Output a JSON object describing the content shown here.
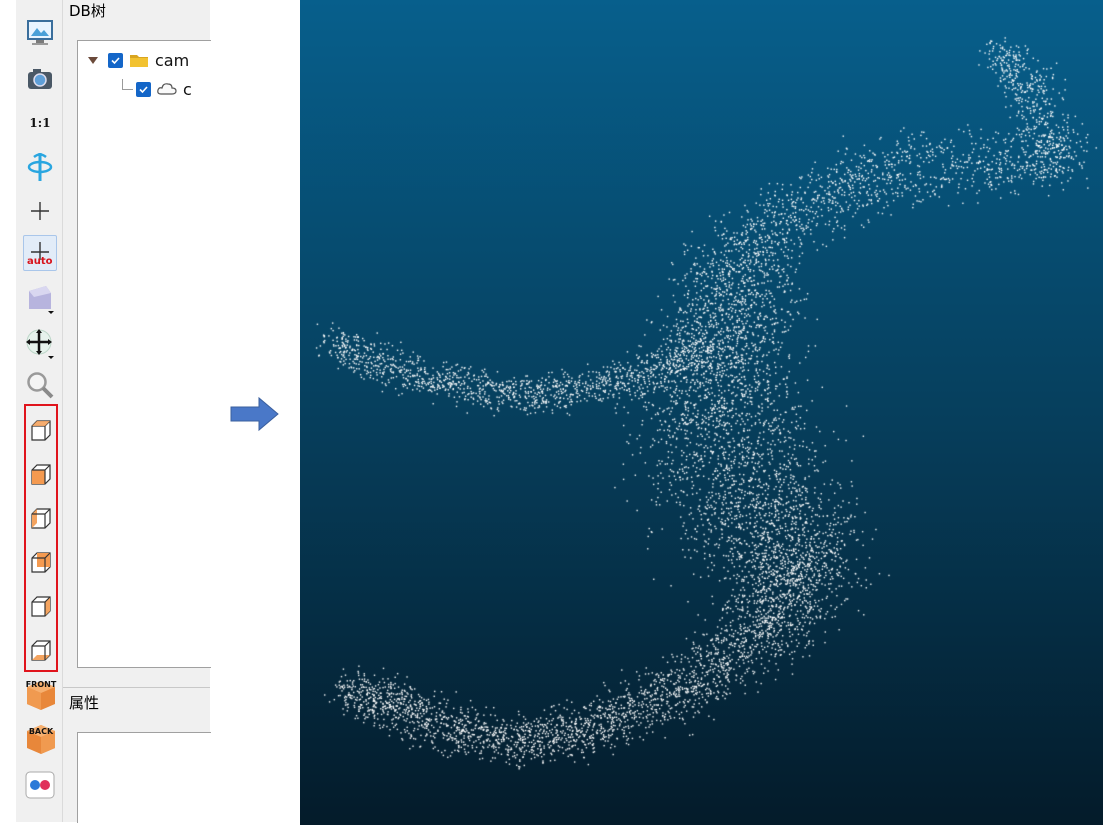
{
  "toolbar": {
    "zoom_label": "1:1",
    "front_label": "FRONT",
    "back_label": "BACK",
    "auto_label": "auto",
    "buttons": [
      "display-settings-icon",
      "camera-settings-icon",
      "zoom-1-1-icon",
      "rotation-icon",
      "pivot-icon",
      "pivot-auto-icon",
      "perspective-icon",
      "move-icon",
      "zoom-icon",
      "top-view-icon",
      "front-view-icon",
      "left-view-icon",
      "back-view-icon",
      "right-view-icon",
      "bottom-view-icon",
      "iso-front-icon",
      "iso-back-icon",
      "stereo-icon"
    ]
  },
  "db_tree": {
    "title": "DB树",
    "items": [
      {
        "label": "cam",
        "checked": true,
        "expanded": true,
        "icon": "folder-icon"
      },
      {
        "label": "c",
        "checked": true,
        "icon": "point-cloud-icon"
      }
    ]
  },
  "properties": {
    "title": "属性"
  },
  "viewer": {
    "background_top": "#075f8c",
    "background_bottom": "#041b2a",
    "point_color": "#ffffff"
  },
  "colors": {
    "highlight_box": "#e0141c",
    "arrow": "#4a78c8",
    "checkbox": "#1466c8"
  }
}
